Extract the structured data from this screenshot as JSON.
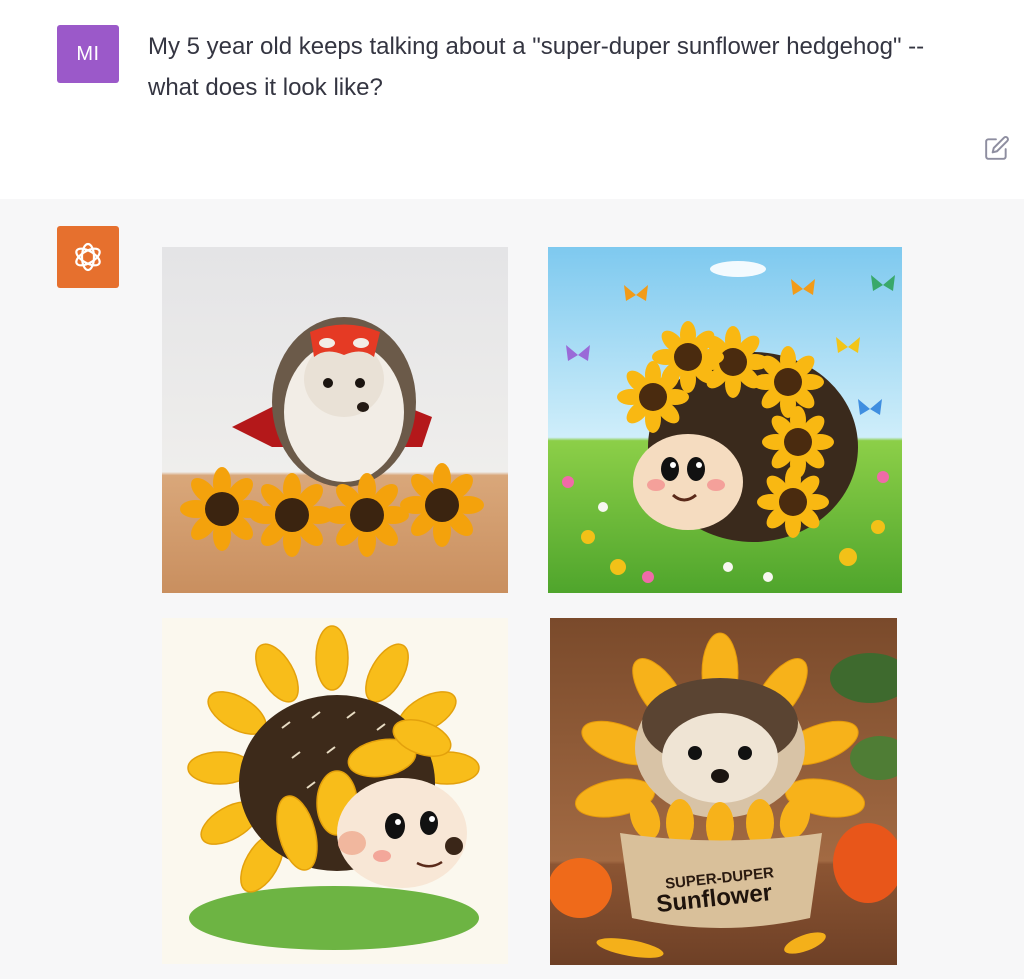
{
  "user": {
    "avatar_initials": "MI",
    "avatar_color": "#9b59c9",
    "message": "My 5 year old keeps talking about a \"super-duper sunflower hedgehog\" -- what does it look like?",
    "edit_icon": "edit-icon"
  },
  "assistant": {
    "avatar_icon": "openai-logo-icon",
    "avatar_color": "#e6702e",
    "images": [
      {
        "description": "photo of hedgehog wearing red mask and cape among sunflowers"
      },
      {
        "description": "cartoon hedgehog with sunflower spines in a meadow with butterflies"
      },
      {
        "description": "illustrated hedgehog framed by giant sunflower petals on grass"
      },
      {
        "description": "hedgehog in a sunflower pot with pumpkins",
        "pot_label": "SUPER-DUPER Sunflower"
      }
    ]
  },
  "colors": {
    "user_bg": "#ffffff",
    "assistant_bg": "#f7f7f8",
    "text": "#343541"
  }
}
